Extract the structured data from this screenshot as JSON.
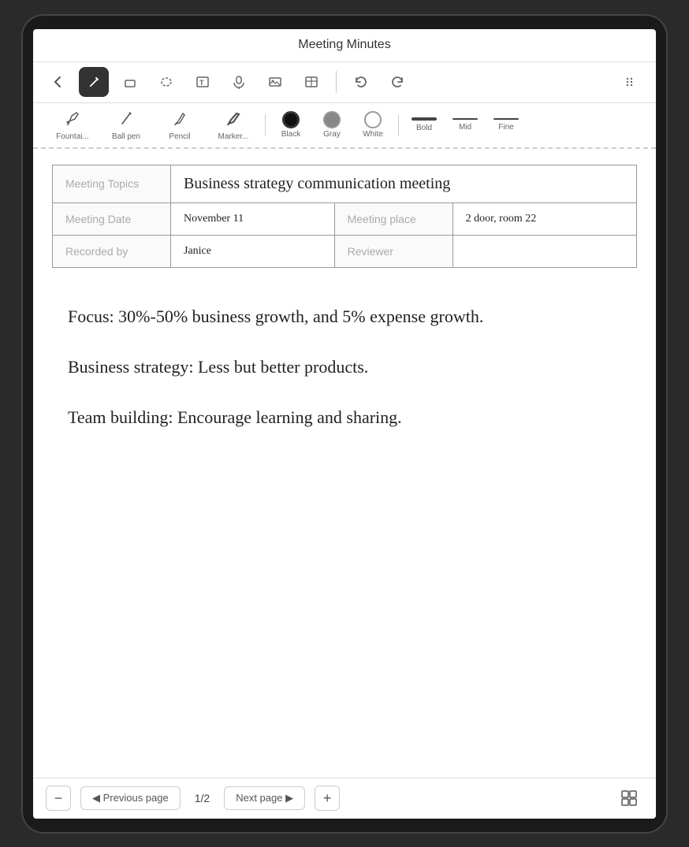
{
  "app": {
    "title": "Meeting Minutes"
  },
  "toolbar": {
    "tools": [
      {
        "id": "back",
        "icon": "←",
        "label": "back",
        "active": false
      },
      {
        "id": "pen",
        "icon": "✏",
        "label": "pen",
        "active": true
      },
      {
        "id": "eraser",
        "icon": "◇",
        "label": "eraser",
        "active": false
      },
      {
        "id": "lasso",
        "icon": "⬭",
        "label": "lasso",
        "active": false
      },
      {
        "id": "text",
        "icon": "T",
        "label": "text",
        "active": false
      },
      {
        "id": "mic",
        "icon": "🎤",
        "label": "microphone",
        "active": false
      },
      {
        "id": "image",
        "icon": "🖼",
        "label": "image",
        "active": false
      },
      {
        "id": "table",
        "icon": "⊞",
        "label": "table",
        "active": false
      },
      {
        "id": "undo",
        "icon": "↩",
        "label": "undo",
        "active": false
      },
      {
        "id": "redo",
        "icon": "↪",
        "label": "redo",
        "active": false
      },
      {
        "id": "more",
        "icon": "⋮⋮",
        "label": "more",
        "active": false
      }
    ]
  },
  "sub_toolbar": {
    "pen_types": [
      {
        "id": "fountain",
        "label": "Fountai..."
      },
      {
        "id": "ballpen",
        "label": "Ball pen"
      },
      {
        "id": "pencil",
        "label": "Pencil"
      },
      {
        "id": "marker",
        "label": "Marker..."
      }
    ],
    "colors": [
      {
        "id": "black",
        "label": "Black",
        "hex": "#111111",
        "selected": true
      },
      {
        "id": "gray",
        "label": "Gray",
        "hex": "#888888",
        "selected": false
      },
      {
        "id": "white",
        "label": "White",
        "hex": "#ffffff",
        "selected": false
      }
    ],
    "weights": [
      {
        "id": "bold",
        "label": "Bold",
        "height": 4
      },
      {
        "id": "mid",
        "label": "Mid",
        "height": 2.5
      },
      {
        "id": "fine",
        "label": "Fine",
        "height": 1.5
      }
    ]
  },
  "table": {
    "rows": [
      {
        "cells": [
          {
            "type": "label",
            "text": "Meeting Topics"
          },
          {
            "type": "value",
            "text": "Business strategy communication meeting",
            "colspan": 3
          }
        ]
      },
      {
        "cells": [
          {
            "type": "label",
            "text": "Meeting Date"
          },
          {
            "type": "value",
            "text": "November 11"
          },
          {
            "type": "label",
            "text": "Meeting place"
          },
          {
            "type": "value",
            "text": "2 door, room 22"
          }
        ]
      },
      {
        "cells": [
          {
            "type": "label",
            "text": "Recorded by"
          },
          {
            "type": "value",
            "text": "Janice"
          },
          {
            "type": "label",
            "text": "Reviewer"
          },
          {
            "type": "value",
            "text": ""
          }
        ]
      }
    ]
  },
  "notes": {
    "lines": [
      "Focus: 30%-50% business growth, and 5% expense growth.",
      "Business strategy: Less but better products.",
      "Team building: Encourage learning and sharing."
    ]
  },
  "bottom_bar": {
    "prev_label": "◀ Previous page",
    "page_indicator": "1/2",
    "next_label": "Next page ▶",
    "minus": "−",
    "plus": "+"
  }
}
